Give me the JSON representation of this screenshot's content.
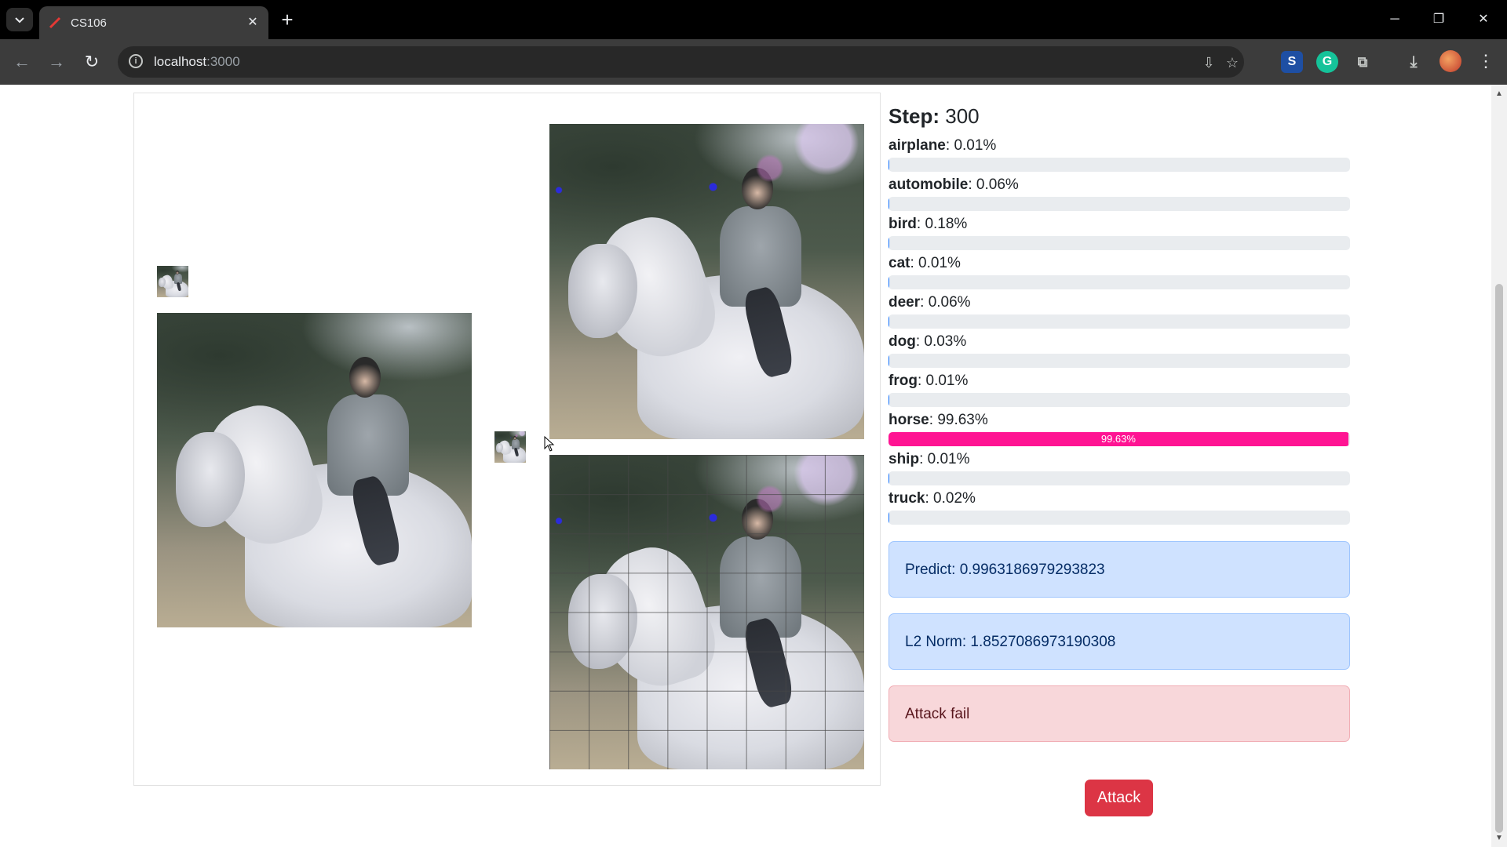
{
  "browser": {
    "tab_title": "CS106",
    "url_host": "localhost",
    "url_port": ":3000"
  },
  "step": {
    "label": "Step:",
    "value": "300"
  },
  "predictions": [
    {
      "name": "airplane",
      "percent_text": "0.01%",
      "value": 0.01
    },
    {
      "name": "automobile",
      "percent_text": "0.06%",
      "value": 0.06
    },
    {
      "name": "bird",
      "percent_text": "0.18%",
      "value": 0.18
    },
    {
      "name": "cat",
      "percent_text": "0.01%",
      "value": 0.01
    },
    {
      "name": "deer",
      "percent_text": "0.06%",
      "value": 0.06
    },
    {
      "name": "dog",
      "percent_text": "0.03%",
      "value": 0.03
    },
    {
      "name": "frog",
      "percent_text": "0.01%",
      "value": 0.01
    },
    {
      "name": "horse",
      "percent_text": "99.63%",
      "value": 99.63,
      "bar_label": "99.63%"
    },
    {
      "name": "ship",
      "percent_text": "0.01%",
      "value": 0.01
    },
    {
      "name": "truck",
      "percent_text": "0.02%",
      "value": 0.02
    }
  ],
  "alerts": {
    "predict": "Predict: 0.9963186979293823",
    "l2": "L2 Norm: 1.8527086973190308",
    "status": "Attack fail"
  },
  "attack_button": "Attack",
  "colors": {
    "highlight_bar": "#ff1493",
    "bar": "#0d6efd",
    "button": "#dc3545"
  },
  "icons": {
    "tab_search": "chevron-down-icon",
    "favicon": "red-slash-icon",
    "close": "close-icon",
    "new_tab": "plus-icon",
    "back": "arrow-left-icon",
    "forward": "arrow-right-icon",
    "reload": "reload-icon",
    "info": "info-icon"
  }
}
